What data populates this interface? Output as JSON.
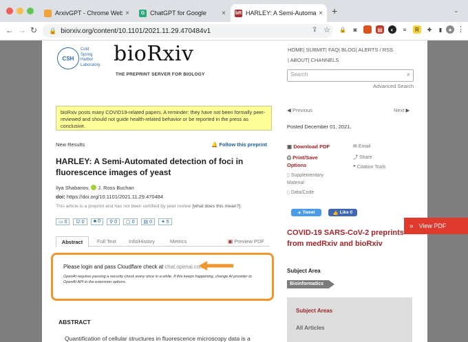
{
  "browser": {
    "tabs": [
      {
        "title": "ArxivGPT - Chrome Web Store",
        "active": false
      },
      {
        "title": "ChatGPT for Google",
        "active": false
      },
      {
        "title": "HARLEY: A Semi-Automated de",
        "active": true
      }
    ],
    "new_tab": "+",
    "url": "biorxiv.org/content/10.1101/2021.11.29.470484v1"
  },
  "logo": {
    "csh_mark": "CSH",
    "csh_text": "Cold\nSpring\nHarbor\nLaboratory",
    "brand": "bioRxiv",
    "tagline": "THE PREPRINT SERVER FOR BIOLOGY"
  },
  "topnav": {
    "line1": [
      "HOME",
      "SUBMIT",
      "FAQ",
      "BLOG",
      "ALERTS / RSS"
    ],
    "line2": [
      "ABOUT",
      "CHANNELS"
    ]
  },
  "search": {
    "placeholder": "Search",
    "advanced": "Advanced Search"
  },
  "notice": "bioRxiv posts many COVID19-related papers. A reminder: they have not been formally peer-reviewed and should not guide health-related behavior or be reported in the press as conclusive.",
  "pager": {
    "previous": "Previous",
    "next": "Next"
  },
  "posted": "Posted December 01, 2021.",
  "article": {
    "section": "New Results",
    "follow": "Follow this preprint",
    "title": "HARLEY: A Semi-Automated detection of foci in fluorescence images of yeast",
    "authors_a": "Ilya Shabanov,",
    "authors_b": "J. Ross Buchan",
    "doi_label": "doi:",
    "doi": "https://doi.org/10.1101/2021.11.29.470484",
    "disclaimer": "This article is a preprint and has not been certified by peer review",
    "disclaimer_link": "[what does this mean?]",
    "disclaimer_end": ".",
    "metrics": [
      "0",
      "0",
      "0",
      "0",
      "0",
      "0",
      "5"
    ],
    "tabs": [
      "Abstract",
      "Full Text",
      "Info/History",
      "Metrics",
      "Preview PDF"
    ],
    "abstract_heading": "ABSTRACT",
    "abstract_start": "Quantification of cellular structures in fluorescence microscopy data is a"
  },
  "extension_box": {
    "login_text": "Please login and pass Cloudflare check at",
    "login_link": "chat.openai.com",
    "note": "OpenAI requires passing a security check every once in a while. If this keeps happening, change AI provider to OpenAI API in the extension options."
  },
  "actions": {
    "download": "Download PDF",
    "print": "Print/Save Options",
    "supplementary": "Supplementary Material",
    "data_code": "Data/Code",
    "email": "Email",
    "share": "Share",
    "citation": "Citation Tools",
    "tweet": "Tweet",
    "like": "Like 0"
  },
  "sidebar": {
    "covid": "COVID-19 SARS-CoV-2 preprints from medRxiv and bioRxiv",
    "subject_area_label": "Subject Area",
    "subject_tag": "Bioinformatics",
    "subject_areas_heading": "Subject Areas",
    "all_articles": "All Articles"
  },
  "view_pdf": "View PDF",
  "colors": {
    "brand_red": "#a32428",
    "notice_bg": "#ffff99",
    "highlight_orange": "#f0962e",
    "view_pdf_red": "#e03a2f",
    "twitter": "#4a9be8",
    "facebook": "#4267b2"
  }
}
